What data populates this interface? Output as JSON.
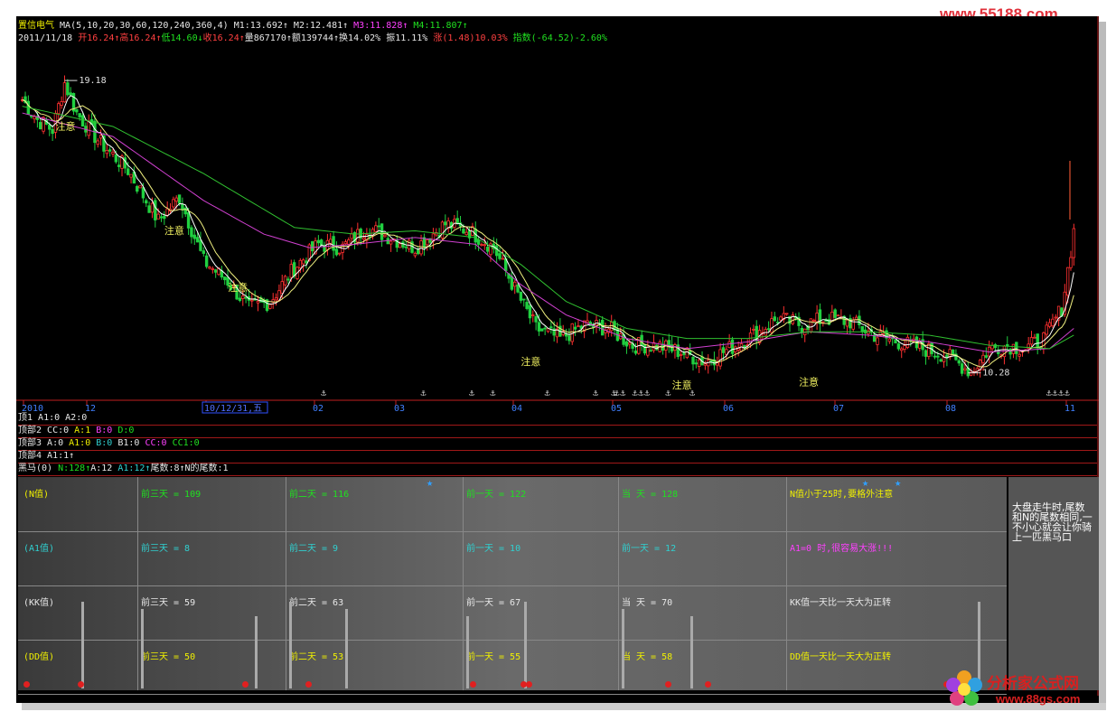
{
  "watermark_top": "www.55188.com",
  "watermark_bottom": {
    "cn": "分析家公式网",
    "url": "www.88gs.com"
  },
  "header": {
    "line1": [
      {
        "t": "置信电气 ",
        "c": "y"
      },
      {
        "t": "MA(5,10,20,30,60,120,240,360,4) ",
        "c": "w"
      },
      {
        "t": "M1:13.692↑ ",
        "c": "w"
      },
      {
        "t": "M2:12.481↑ ",
        "c": "w"
      },
      {
        "t": "M3:11.828↑ ",
        "c": "m"
      },
      {
        "t": "M4:11.807↑",
        "c": "g"
      }
    ],
    "line2": [
      {
        "t": "2011/11/18 ",
        "c": "w"
      },
      {
        "t": "开16.24↑",
        "c": "r"
      },
      {
        "t": "高16.24↑",
        "c": "r"
      },
      {
        "t": "低14.60↓",
        "c": "g"
      },
      {
        "t": "收16.24↑",
        "c": "r"
      },
      {
        "t": "量867170↑",
        "c": "w"
      },
      {
        "t": "额139744↑",
        "c": "w"
      },
      {
        "t": "换14.02% ",
        "c": "w"
      },
      {
        "t": "振11.11% ",
        "c": "w"
      },
      {
        "t": "涨(1.48)10.03% ",
        "c": "r"
      },
      {
        "t": "指数(-64.52)-2.60%",
        "c": "g"
      }
    ]
  },
  "chart_data": {
    "type": "candlestick",
    "title": "置信电气",
    "ylim": [
      9.6,
      19.8
    ],
    "max_label": "19.18",
    "min_label": "10.28",
    "annotation": "注意",
    "x_ticks": [
      "2010",
      "12",
      "10/12/31,五",
      "02",
      "03",
      "04",
      "05",
      "06",
      "07",
      "08",
      "11"
    ],
    "series_names": [
      "M1",
      "M2",
      "M3",
      "M4"
    ],
    "key_points": {
      "close": [
        [
          0,
          18.4
        ],
        [
          5,
          17.8
        ],
        [
          10,
          17.5
        ],
        [
          14,
          18.9
        ],
        [
          18,
          18.0
        ],
        [
          25,
          17.2
        ],
        [
          35,
          16.3
        ],
        [
          45,
          14.8
        ],
        [
          52,
          15.5
        ],
        [
          60,
          13.6
        ],
        [
          68,
          13.0
        ],
        [
          75,
          12.2
        ],
        [
          82,
          12.4
        ],
        [
          90,
          13.4
        ],
        [
          98,
          14.1
        ],
        [
          106,
          14.0
        ],
        [
          114,
          14.6
        ],
        [
          122,
          14.3
        ],
        [
          130,
          14.0
        ],
        [
          140,
          14.7
        ],
        [
          148,
          14.5
        ],
        [
          156,
          14.0
        ],
        [
          164,
          12.6
        ],
        [
          170,
          11.6
        ],
        [
          178,
          11.3
        ],
        [
          186,
          11.7
        ],
        [
          194,
          11.6
        ],
        [
          202,
          11.1
        ],
        [
          210,
          11.1
        ],
        [
          218,
          10.9
        ],
        [
          226,
          10.6
        ],
        [
          234,
          11.0
        ],
        [
          242,
          11.4
        ],
        [
          250,
          11.9
        ],
        [
          258,
          11.7
        ],
        [
          266,
          11.9
        ],
        [
          274,
          11.8
        ],
        [
          282,
          11.4
        ],
        [
          290,
          11.2
        ],
        [
          298,
          11.0
        ],
        [
          306,
          10.8
        ],
        [
          314,
          10.3
        ],
        [
          320,
          11.0
        ],
        [
          326,
          11.1
        ],
        [
          332,
          11.0
        ],
        [
          338,
          11.3
        ],
        [
          344,
          12.2
        ],
        [
          348,
          14.5
        ]
      ],
      "M4": [
        [
          0,
          18.2
        ],
        [
          30,
          17.6
        ],
        [
          60,
          16.2
        ],
        [
          90,
          14.6
        ],
        [
          110,
          14.4
        ],
        [
          130,
          14.5
        ],
        [
          150,
          14.3
        ],
        [
          165,
          13.5
        ],
        [
          180,
          12.4
        ],
        [
          200,
          11.6
        ],
        [
          220,
          11.3
        ],
        [
          240,
          11.3
        ],
        [
          260,
          11.5
        ],
        [
          280,
          11.5
        ],
        [
          300,
          11.4
        ],
        [
          320,
          11.1
        ],
        [
          340,
          11.0
        ],
        [
          348,
          11.4
        ]
      ],
      "M3": [
        [
          0,
          18.0
        ],
        [
          30,
          17.3
        ],
        [
          60,
          15.4
        ],
        [
          80,
          14.4
        ],
        [
          95,
          14.0
        ],
        [
          110,
          14.1
        ],
        [
          130,
          14.3
        ],
        [
          150,
          14.1
        ],
        [
          165,
          12.9
        ],
        [
          180,
          12.0
        ],
        [
          200,
          11.3
        ],
        [
          220,
          11.0
        ],
        [
          240,
          11.2
        ],
        [
          260,
          11.5
        ],
        [
          280,
          11.4
        ],
        [
          300,
          11.2
        ],
        [
          320,
          10.9
        ],
        [
          340,
          11.0
        ],
        [
          348,
          11.6
        ]
      ]
    },
    "markers_x": [
      100,
      133,
      149,
      156,
      174,
      190,
      196,
      197,
      199,
      203,
      205,
      207,
      214,
      222,
      340,
      342,
      344,
      346
    ]
  },
  "subcharts": [
    {
      "name": "顶1",
      "items": [
        {
          "t": "顶1 ",
          "c": "w"
        },
        {
          "t": "A1:0 ",
          "c": "w"
        },
        {
          "t": "A2:0",
          "c": "w"
        }
      ]
    },
    {
      "name": "顶部2",
      "items": [
        {
          "t": "顶部2 ",
          "c": "w"
        },
        {
          "t": "CC:0 ",
          "c": "w"
        },
        {
          "t": "A:1 ",
          "c": "y"
        },
        {
          "t": "B:0 ",
          "c": "m"
        },
        {
          "t": "D:0",
          "c": "g"
        }
      ]
    },
    {
      "name": "顶部3",
      "items": [
        {
          "t": "顶部3 ",
          "c": "w"
        },
        {
          "t": "A:0 ",
          "c": "w"
        },
        {
          "t": "A1:0 ",
          "c": "y"
        },
        {
          "t": "B:0 ",
          "c": "c"
        },
        {
          "t": "B1:0 ",
          "c": "w"
        },
        {
          "t": "CC:0 ",
          "c": "m"
        },
        {
          "t": "CC1:0",
          "c": "g"
        }
      ]
    },
    {
      "name": "顶部4",
      "items": [
        {
          "t": "顶部4 ",
          "c": "w"
        },
        {
          "t": "A1:1↑",
          "c": "w"
        }
      ]
    },
    {
      "name": "黑马",
      "items": [
        {
          "t": "黑马(0) ",
          "c": "w"
        },
        {
          "t": "N:128↑",
          "c": "g"
        },
        {
          "t": "A:12 ",
          "c": "w"
        },
        {
          "t": "A1:12↑",
          "c": "c"
        },
        {
          "t": "尾数:8↑",
          "c": "w"
        },
        {
          "t": "N的尾数:1",
          "c": "w"
        }
      ]
    }
  ],
  "table": {
    "rows": [
      {
        "label": "(N值)",
        "c": "y",
        "cells": [
          "前三天 = 109",
          "前二天 = 116",
          "前一天 = 122",
          "当  天 = 128"
        ],
        "note": "N值小于25时,要格外注意",
        "note_c": "y",
        "cc": "g"
      },
      {
        "label": "(A1值)",
        "c": "c",
        "cells": [
          "前三天 = 8",
          "前二天 = 9",
          "前一天 = 10",
          "前一天 = 12"
        ],
        "note": "A1=0 时,很容易大涨!!!",
        "note_c": "m",
        "cc": "c"
      },
      {
        "label": "(KK值)",
        "c": "w",
        "cells": [
          "前三天 = 59",
          "前二天 = 63",
          "前一天 = 67",
          "当  天 = 70"
        ],
        "note": "KK值一天比一天大为正转",
        "note_c": "w",
        "cc": "w"
      },
      {
        "label": "(DD值)",
        "c": "y",
        "cells": [
          "前三天 = 50",
          "前二天 = 53",
          "前一天 = 55",
          "当  天 = 58"
        ],
        "note": "DD值一天比一天大为正转",
        "note_c": "y",
        "cc": "y"
      }
    ]
  },
  "side_note": "大盘走牛时,尾数和N的尾数相同,一不小心就会让你骑上一匹黑马口",
  "colors": {
    "up": "#ff3030",
    "down": "#20d040",
    "M1": "#ffffff",
    "M2": "#f0f080",
    "M3": "#d040d0",
    "M4": "#30c030"
  }
}
